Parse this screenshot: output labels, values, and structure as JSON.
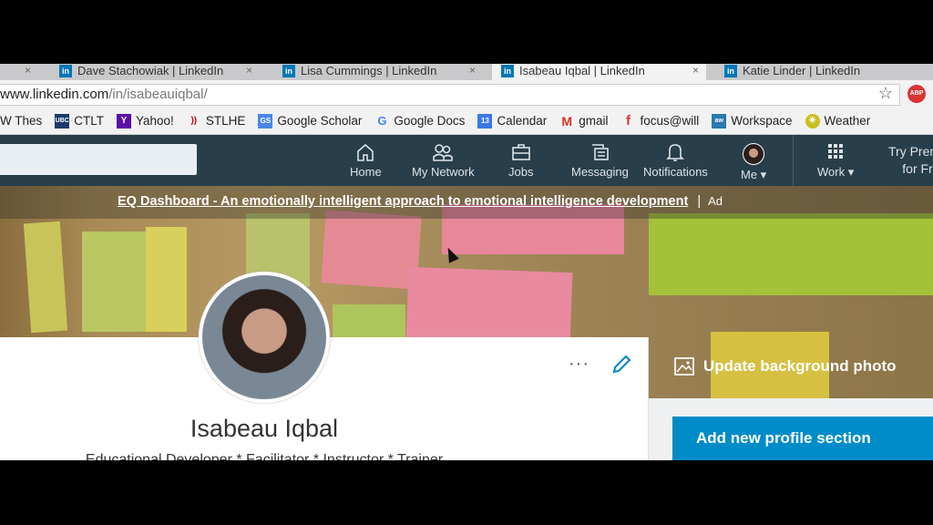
{
  "browser": {
    "tabs": [
      {
        "title": "Dave Stachowiak | LinkedIn",
        "active": false
      },
      {
        "title": "Lisa Cummings | LinkedIn",
        "active": false
      },
      {
        "title": "Isabeau Iqbal | LinkedIn",
        "active": true
      },
      {
        "title": "Katie Linder | LinkedIn",
        "active": false
      }
    ],
    "url_host": "www.linkedin.com",
    "url_path": "/in/isabeauiqbal/",
    "bookmarks": [
      {
        "label": "W Thes",
        "icon": ""
      },
      {
        "label": "CTLT",
        "icon": "UBC"
      },
      {
        "label": "Yahoo!",
        "icon": "Y"
      },
      {
        "label": "STLHE",
        "icon": "))"
      },
      {
        "label": "Google Scholar",
        "icon": "GS"
      },
      {
        "label": "Google Docs",
        "icon": "G"
      },
      {
        "label": "Calendar",
        "icon": "13"
      },
      {
        "label": "gmail",
        "icon": "M"
      },
      {
        "label": "focus@will",
        "icon": "f"
      },
      {
        "label": "Workspace",
        "icon": "aw"
      },
      {
        "label": "Weather",
        "icon": "☀"
      }
    ]
  },
  "nav": {
    "items": [
      {
        "label": "Home",
        "icon": "home-icon"
      },
      {
        "label": "My Network",
        "icon": "network-icon"
      },
      {
        "label": "Jobs",
        "icon": "briefcase-icon"
      },
      {
        "label": "Messaging",
        "icon": "messaging-icon"
      },
      {
        "label": "Notifications",
        "icon": "bell-icon"
      },
      {
        "label": "Me ▾",
        "icon": "avatar"
      },
      {
        "label": "Work ▾",
        "icon": "grid-icon"
      }
    ],
    "premium_line1": "Try Premium",
    "premium_line2": "for Free"
  },
  "ad": {
    "text": "EQ Dashboard - An emotionally intelligent approach to emotional intelligence development",
    "separator": "|",
    "label": "Ad"
  },
  "profile": {
    "name": "Isabeau Iqbal",
    "headline": "Educational Developer * Facilitator * Instructor * Trainer",
    "more": "···"
  },
  "sidebar": {
    "update_bg": "Update background photo",
    "add_section": "Add new profile section"
  },
  "colors": {
    "nav": "#283e4a",
    "accent": "#008cc9"
  }
}
